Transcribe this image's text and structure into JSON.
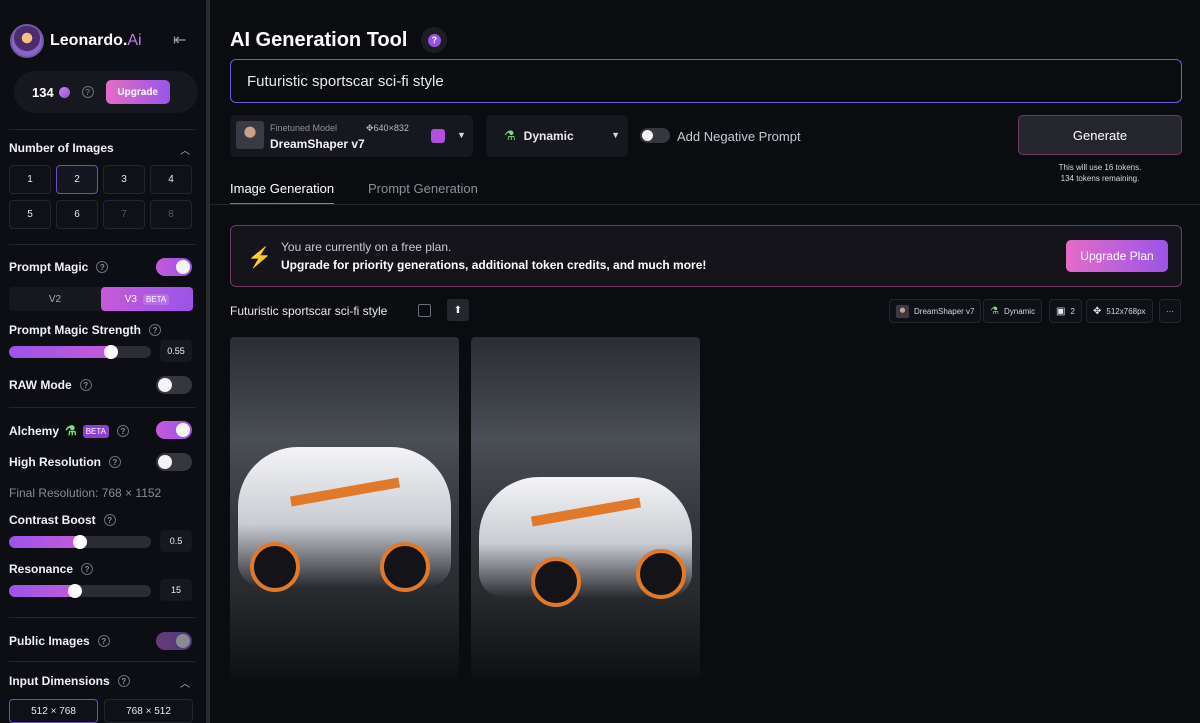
{
  "brand": {
    "name": "Leonardo.",
    "suffix": "Ai"
  },
  "sidebar": {
    "tokens": "134",
    "upgrade_label": "Upgrade",
    "num_images": {
      "title": "Number of Images",
      "options": [
        "1",
        "2",
        "3",
        "4",
        "5",
        "6",
        "7",
        "8"
      ],
      "selected": "2"
    },
    "prompt_magic": {
      "label": "Prompt Magic",
      "enabled": true
    },
    "versions": {
      "v2": "V2",
      "v3": "V3",
      "beta": "BETA",
      "selected": "V3"
    },
    "prompt_magic_strength": {
      "label": "Prompt Magic Strength",
      "value": "0.55"
    },
    "raw_mode": {
      "label": "RAW Mode",
      "enabled": false
    },
    "alchemy": {
      "label": "Alchemy",
      "beta": "BETA",
      "enabled": true
    },
    "high_resolution": {
      "label": "High Resolution",
      "enabled": false
    },
    "final_resolution": "Final Resolution: 768 × 1152",
    "contrast_boost": {
      "label": "Contrast Boost",
      "value": "0.5"
    },
    "resonance": {
      "label": "Resonance",
      "value": "15"
    },
    "public_images": {
      "label": "Public Images",
      "enabled": true
    },
    "input_dimensions": {
      "title": "Input Dimensions",
      "options": [
        "512 × 768",
        "768 × 512"
      ],
      "selected": "512 × 768"
    }
  },
  "main": {
    "title": "AI Generation Tool",
    "prompt": "Futuristic sportscar sci-fi style",
    "model": {
      "kicker": "Finetuned Model",
      "dims": "640×832",
      "name": "DreamShaper v7"
    },
    "style": "Dynamic",
    "negative_prompt_label": "Add Negative Prompt",
    "generate_label": "Generate",
    "token_note_1": "This will use 16 tokens.",
    "token_note_2": "134 tokens remaining.",
    "tabs": [
      "Image Generation",
      "Prompt Generation"
    ],
    "banner": {
      "line1": "You are currently on a free plan.",
      "line2": "Upgrade for priority generations, additional token credits, and much more!",
      "button": "Upgrade Plan"
    },
    "generation": {
      "prompt": "Futuristic sportscar sci-fi style",
      "chips": {
        "model": "DreamShaper v7",
        "style": "Dynamic",
        "count": "2",
        "size": "512x768px",
        "more": "···"
      }
    }
  },
  "colors": {
    "accent_pink": "#e56cc8",
    "accent_purple": "#9a55e8",
    "bg": "#0b0c10"
  }
}
